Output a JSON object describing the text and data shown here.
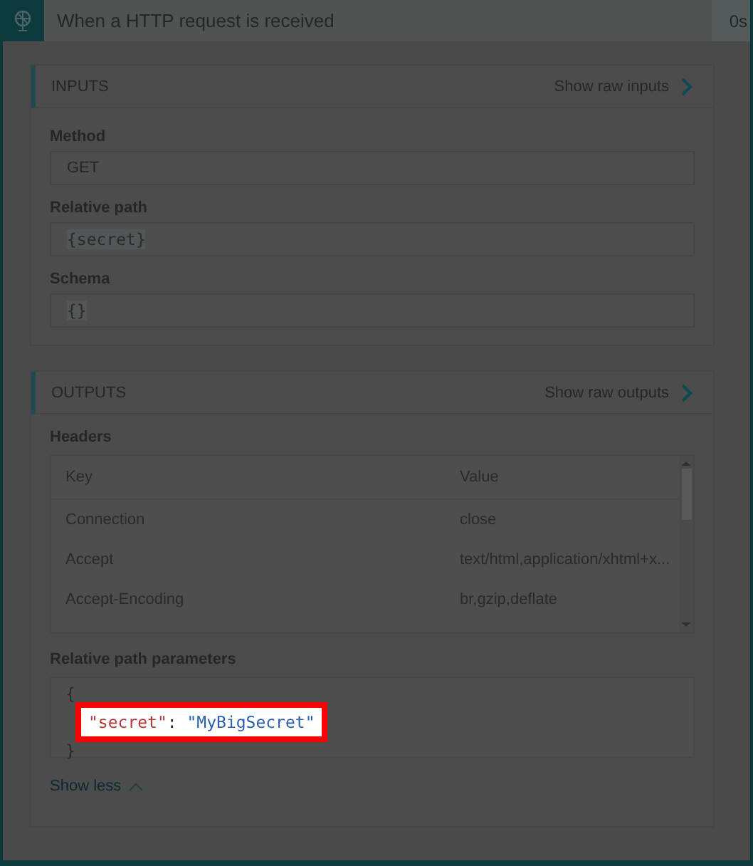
{
  "header": {
    "title": "When a HTTP request is received",
    "duration": "0s"
  },
  "inputs": {
    "title": "INPUTS",
    "raw_link": "Show raw inputs",
    "fields": [
      {
        "label": "Method",
        "value": "GET",
        "kind": "text"
      },
      {
        "label": "Relative path",
        "value": "{secret}",
        "kind": "code"
      },
      {
        "label": "Schema",
        "value": "{}",
        "kind": "code"
      }
    ]
  },
  "outputs": {
    "title": "OUTPUTS",
    "raw_link": "Show raw outputs",
    "headers": {
      "label": "Headers",
      "columns": [
        "Key",
        "Value"
      ],
      "rows": [
        [
          "Connection",
          "close"
        ],
        [
          "Accept",
          "text/html,application/xhtml+x..."
        ],
        [
          "Accept-Encoding",
          "br,gzip,deflate"
        ]
      ]
    },
    "params": {
      "label": "Relative path parameters",
      "lines": [
        {
          "kind": "brace",
          "text": "{",
          "highlighted": false
        },
        {
          "kind": "pair",
          "key": "\"secret\"",
          "sep": ": ",
          "value": "\"MyBigSecret\"",
          "highlighted": true
        },
        {
          "kind": "brace",
          "text": "}",
          "highlighted": false
        }
      ]
    },
    "show_less": "Show less"
  }
}
